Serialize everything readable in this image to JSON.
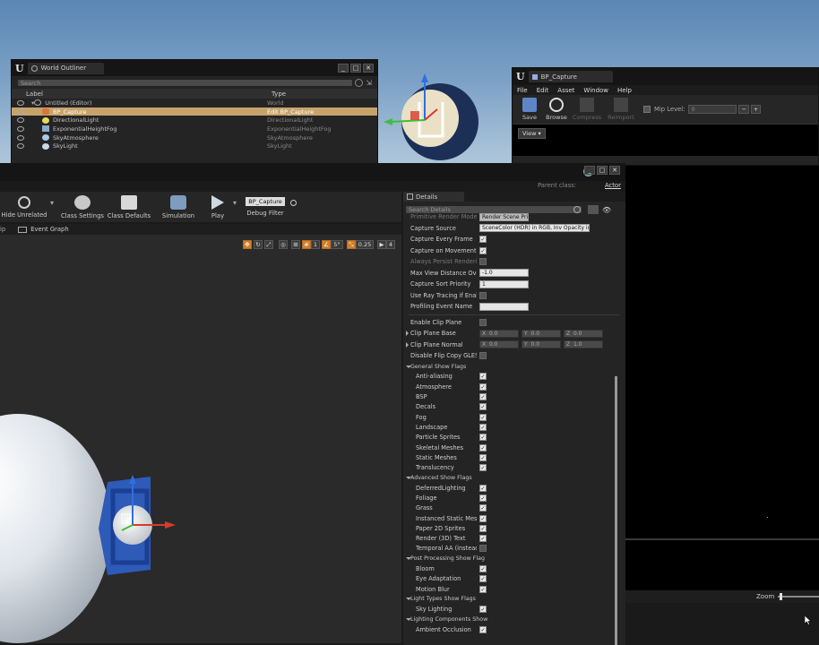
{
  "outliner": {
    "title": "World Outliner",
    "search_placeholder": "Search",
    "col_label": "Label",
    "col_type": "Type",
    "rows": [
      {
        "label": "Untitled (Editor)",
        "type": "World"
      },
      {
        "label": "BP_Capture",
        "type": "Edit BP_Capture"
      },
      {
        "label": "DirectionalLight",
        "type": "DirectionalLight"
      },
      {
        "label": "ExponentialHeightFog",
        "type": "ExponentialHeightFog"
      },
      {
        "label": "SkyAtmosphere",
        "type": "SkyAtmosphere"
      },
      {
        "label": "SkyLight",
        "type": "SkyLight"
      }
    ]
  },
  "bp_window": {
    "title": "BP_Capture",
    "menu": [
      "File",
      "Edit",
      "Asset",
      "Window",
      "Help"
    ],
    "toolbar": {
      "save": "Save",
      "browse": "Browse",
      "compress": "Compress",
      "reimport": "Reimport",
      "mip_level": "Mip Level:",
      "mip_value": "0"
    },
    "view_label": "View",
    "zoom_label": "Zoom"
  },
  "editor": {
    "parent_class_label": "Parent class:",
    "parent_class_value": "Actor",
    "toolbar": {
      "hide_unrelated": "Hide Unrelated",
      "class_settings": "Class Settings",
      "class_defaults": "Class Defaults",
      "simulation": "Simulation",
      "play": "Play",
      "debug_object": "BP_Capture",
      "debug_filter": "Debug Filter"
    },
    "tabs": {
      "left_stub": "ip",
      "event_graph": "Event Graph"
    },
    "viewport_controls": {
      "snap_grid": "1",
      "rot_snap": "5°",
      "scale_snap": "0.25",
      "cam_speed": "4"
    }
  },
  "details": {
    "title": "Details",
    "search_placeholder": "Search Details",
    "rows": [
      {
        "name": "Primitive Render Mode",
        "kind": "field",
        "value": "Render Scene Primitives (Legacy)",
        "dim": true
      },
      {
        "name": "Capture Source",
        "kind": "dropdown",
        "value": "SceneColor (HDR) in RGB, Inv Opacity in A"
      },
      {
        "name": "Capture Every Frame",
        "kind": "check",
        "checked": true
      },
      {
        "name": "Capture on Movement",
        "kind": "check",
        "checked": true
      },
      {
        "name": "Always Persist Rendering S",
        "kind": "check",
        "checked": false,
        "dim": true
      },
      {
        "name": "Max View Distance Overrid",
        "kind": "field",
        "value": "-1.0"
      },
      {
        "name": "Capture Sort Priority",
        "kind": "field",
        "value": "1"
      },
      {
        "name": "Use Ray Tracing if Enabled",
        "kind": "check",
        "checked": false
      },
      {
        "name": "Profiling Event Name",
        "kind": "field",
        "value": ""
      }
    ],
    "clip_rows": [
      {
        "name": "Enable Clip Plane",
        "kind": "check",
        "checked": false
      },
      {
        "name": "Clip Plane Base",
        "kind": "vector",
        "x": "0.0",
        "y": "0.0",
        "z": "0.0"
      },
      {
        "name": "Clip Plane Normal",
        "kind": "vector",
        "x": "0.0",
        "y": "0.0",
        "z": "1.0"
      },
      {
        "name": "Disable Flip Copy GLES",
        "kind": "check",
        "checked": false
      }
    ],
    "vec_labels": {
      "x": "X",
      "y": "Y",
      "z": "Z"
    },
    "categories": [
      {
        "name": "General Show Flags",
        "flags": [
          {
            "name": "Anti-aliasing",
            "checked": true
          },
          {
            "name": "Atmosphere",
            "checked": true
          },
          {
            "name": "BSP",
            "checked": true
          },
          {
            "name": "Decals",
            "checked": true
          },
          {
            "name": "Fog",
            "checked": true
          },
          {
            "name": "Landscape",
            "checked": true
          },
          {
            "name": "Particle Sprites",
            "checked": true
          },
          {
            "name": "Skeletal Meshes",
            "checked": true
          },
          {
            "name": "Static Meshes",
            "checked": true
          },
          {
            "name": "Translucency",
            "checked": true
          }
        ]
      },
      {
        "name": "Advanced Show Flags",
        "flags": [
          {
            "name": "DeferredLighting",
            "checked": true
          },
          {
            "name": "Foliage",
            "checked": true
          },
          {
            "name": "Grass",
            "checked": true
          },
          {
            "name": "Instanced Static Meshe",
            "checked": true
          },
          {
            "name": "Paper 2D Sprites",
            "checked": true
          },
          {
            "name": "Render (3D) Text",
            "checked": true
          },
          {
            "name": "Temporal AA (instead F",
            "checked": false
          }
        ]
      },
      {
        "name": "Post Processing Show Flag",
        "flags": [
          {
            "name": "Bloom",
            "checked": true
          },
          {
            "name": "Eye Adaptation",
            "checked": true
          },
          {
            "name": "Motion Blur",
            "checked": true
          }
        ]
      },
      {
        "name": "Light Types Show Flags",
        "flags": [
          {
            "name": "Sky Lighting",
            "checked": true
          }
        ]
      },
      {
        "name": "Lighting Components Show",
        "flags": [
          {
            "name": "Ambient Occlusion",
            "checked": true
          }
        ]
      }
    ]
  },
  "colors": {
    "selection": "#c7a36c",
    "accent_orange": "#d0802e",
    "panel": "#242424",
    "sky": "#7ca1c6"
  }
}
